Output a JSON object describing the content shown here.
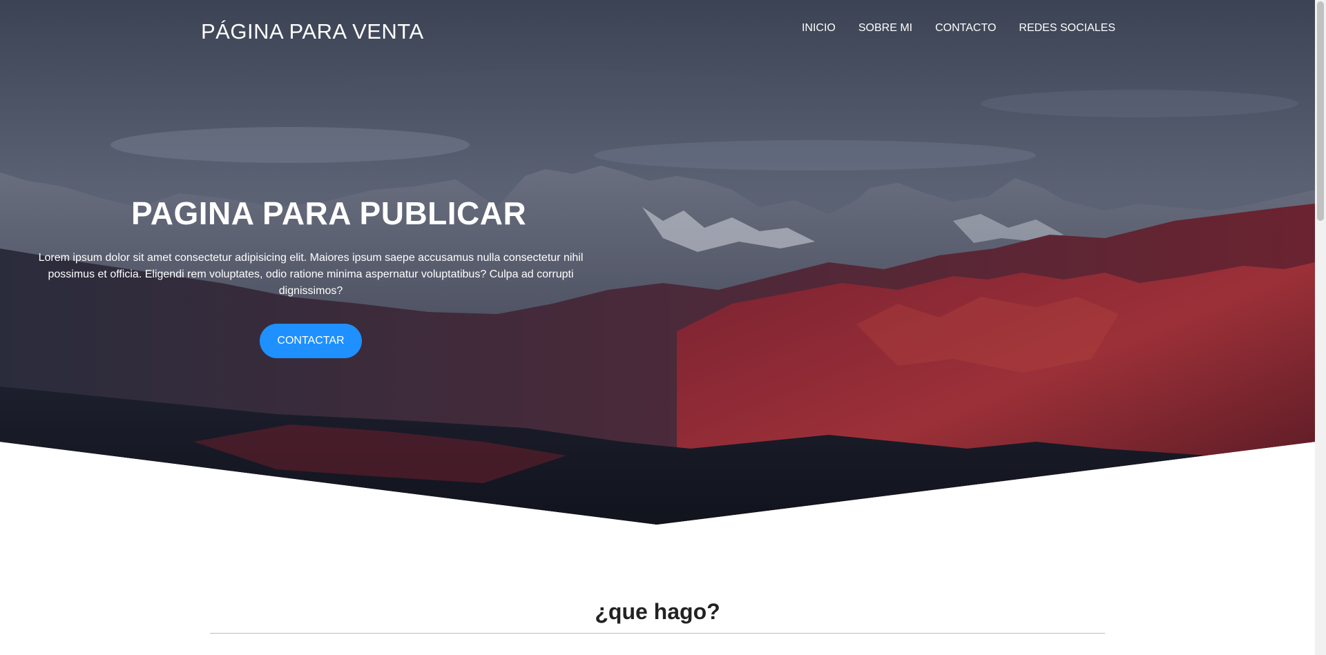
{
  "colors": {
    "accent": "#1e90ff",
    "sky_dark": "#353c4c",
    "mountain_red": "#8e2a38"
  },
  "header": {
    "logo": "PÁGINA PARA VENTA",
    "nav": [
      "INICIO",
      "SOBRE MI",
      "CONTACTO",
      "REDES SOCIALES"
    ]
  },
  "hero": {
    "title": "PAGINA PARA PUBLICAR",
    "text": "Lorem ipsum dolor sit amet consectetur adipisicing elit. Maiores ipsum saepe accusamus nulla consectetur nihil possimus et officia. Eligendi rem voluptates, odio ratione minima aspernatur voluptatibus? Culpa ad corrupti dignissimos?",
    "cta": "CONTACTAR"
  },
  "section": {
    "title": "¿que hago?"
  }
}
